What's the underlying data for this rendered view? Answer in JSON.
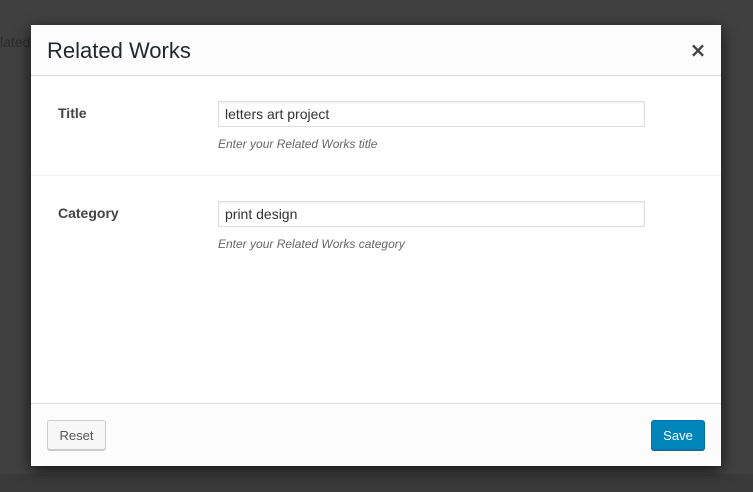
{
  "backdrop": {
    "partial_text": "lated"
  },
  "modal": {
    "title": "Related Works",
    "close_symbol": "×",
    "close_icon": "close-icon"
  },
  "fields": {
    "title": {
      "label": "Title",
      "value": "letters art project",
      "description": "Enter your Related Works title"
    },
    "category": {
      "label": "Category",
      "value": "print design",
      "description": "Enter your Related Works category"
    }
  },
  "footer": {
    "reset_label": "Reset",
    "save_label": "Save"
  },
  "colors": {
    "overlay": "#404040",
    "primary_button": "#0085ba",
    "modal_background": "#ffffff",
    "header_footer_background": "#fcfcfc"
  }
}
